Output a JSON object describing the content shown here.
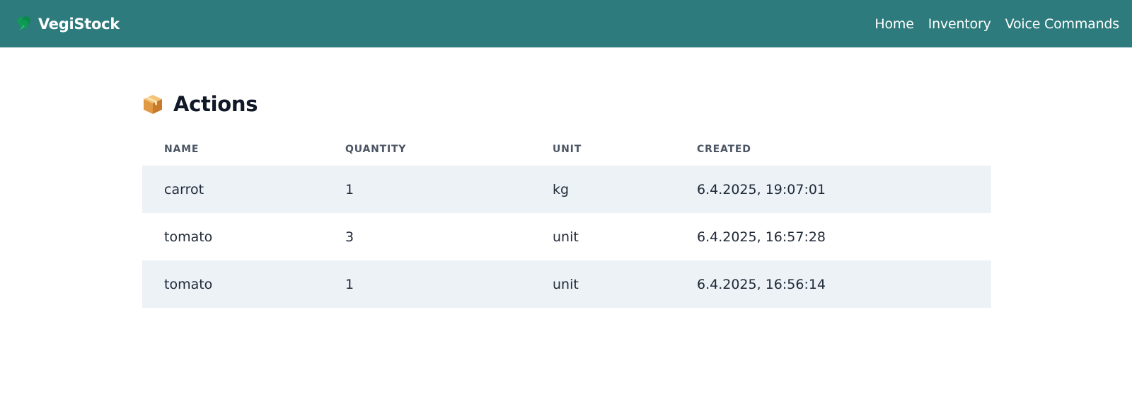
{
  "navbar": {
    "brand": "VegiStock",
    "brand_icon": "broccoli-icon",
    "links": [
      {
        "label": "Home"
      },
      {
        "label": "Inventory"
      },
      {
        "label": "Voice Commands"
      }
    ],
    "background_color": "#2e7b7d"
  },
  "main": {
    "title": "Actions",
    "title_icon": "package-box-icon",
    "table": {
      "columns": [
        "Name",
        "Quantity",
        "Unit",
        "Created"
      ],
      "rows": [
        {
          "name": "carrot",
          "quantity": "1",
          "unit": "kg",
          "created": "6.4.2025, 19:07:01"
        },
        {
          "name": "tomato",
          "quantity": "3",
          "unit": "unit",
          "created": "6.4.2025, 16:57:28"
        },
        {
          "name": "tomato",
          "quantity": "1",
          "unit": "unit",
          "created": "6.4.2025, 16:56:14"
        }
      ],
      "striped_row_color": "#edf2f7"
    }
  }
}
